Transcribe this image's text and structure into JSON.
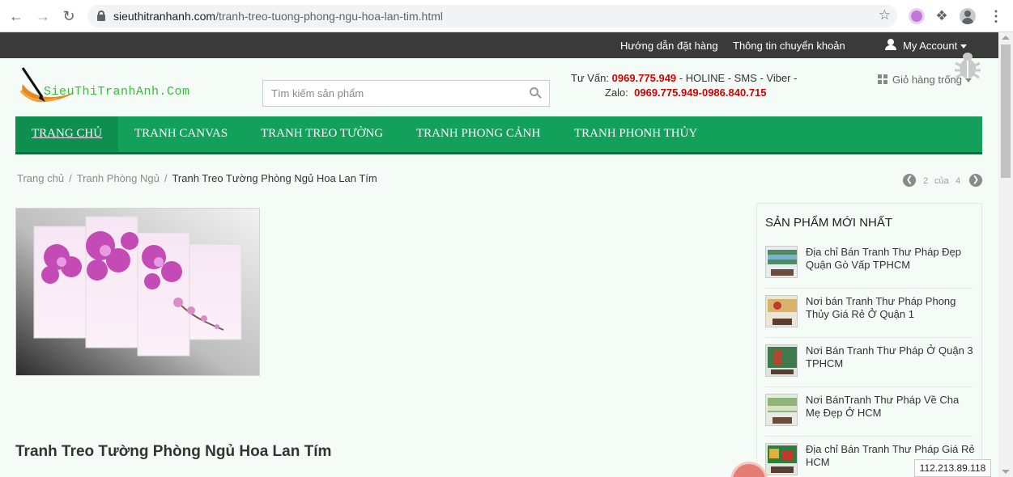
{
  "browser": {
    "url_domain": "sieuthitranhanh.com",
    "url_path": "/tranh-treo-tuong-phong-ngu-hoa-lan-tim.html"
  },
  "topbar": {
    "links": [
      "Hướng dẫn đặt hàng",
      "Thông tin chuyển khoản"
    ],
    "account": "My Account"
  },
  "header": {
    "logo_text": "SieuThiTranhAnh.Com",
    "search_placeholder": "Tìm kiếm sản phẩm",
    "consult_label": "Tư Vấn:",
    "consult_phone": "0969.775.949",
    "consult_channels": "- HOLINE - SMS - Viber -",
    "zalo_label": "Zalo:",
    "zalo_phones": "0969.775.949-0986.840.715",
    "cart": "Giỏ hàng trống"
  },
  "nav": {
    "items": [
      "TRANG CHỦ",
      "TRANH CANVAS",
      "TRANH TREO TƯỜNG",
      "TRANH PHONG CẢNH",
      "TRANH PHONH THỦY"
    ]
  },
  "breadcrumb": {
    "home": "Trang chủ",
    "category": "Tranh Phòng Ngủ",
    "current": "Tranh Treo Tường Phòng Ngủ Hoa Lan Tím",
    "sep": "/"
  },
  "pager": {
    "current": "2",
    "of": "của",
    "total": "4"
  },
  "product": {
    "title": "Tranh Treo Tường Phòng Ngủ Hoa Lan Tím"
  },
  "sidebar": {
    "title": "SẢN PHẨM MỚI NHẤT",
    "items": [
      "Địa chỉ Bán Tranh Thư Pháp Đẹp Quận Gò Vấp TPHCM",
      "Nơi bán Tranh Thư Pháp Phong Thủy Giá Rẻ Ở Quận 1",
      "Nơi Bán Tranh Thư Pháp Ở Quận 3 TPHCM",
      "Nơi BánTranh Thư Pháp Về Cha Mẹ Đẹp Ở HCM",
      "Địa chỉ Bán Tranh Thư Pháp Giá Rẻ HCM"
    ]
  },
  "ip_address": "112.213.89.118",
  "colors": {
    "nav_green": "#12a05a",
    "topbar": "#3a3a3a",
    "hotline_red": "#d60000"
  }
}
